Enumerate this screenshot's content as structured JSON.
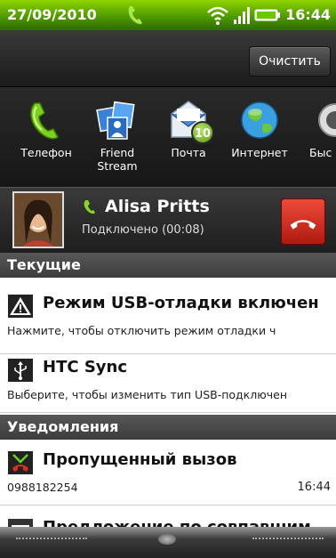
{
  "status_bar": {
    "date": "27/09/2010",
    "time": "16:44"
  },
  "header": {
    "clear_label": "Очистить"
  },
  "apps": [
    {
      "label": "Телефон",
      "icon": "phone-icon"
    },
    {
      "label": "Friend Stream",
      "icon": "friend-stream-icon"
    },
    {
      "label": "Почта",
      "icon": "mail-icon",
      "badge": "10"
    },
    {
      "label": "Интернет",
      "icon": "internet-icon"
    },
    {
      "label": "Быс по",
      "icon": "partial-app-icon"
    }
  ],
  "call": {
    "name": "Alisa Pritts",
    "status": "Подключено (00:08)"
  },
  "sections": {
    "current": "Текущие",
    "notifications": "Уведомления"
  },
  "items": {
    "usb_debug": {
      "title": "Режим USB-отладки включен",
      "subtitle": "Нажмите, чтобы отключить режим отладки ч"
    },
    "htc_sync": {
      "title": "HTC Sync",
      "subtitle": "Выберите, чтобы изменить тип USB-подключен"
    },
    "missed_call": {
      "title": "Пропущенный вызов",
      "number": "0988182254",
      "time": "16:44"
    },
    "suggestion": {
      "title": "Предложение по совпавшим"
    }
  },
  "colors": {
    "status_green": "#6ab400",
    "hangup_red": "#d4281a",
    "section_bg": "#4a4a4a"
  }
}
